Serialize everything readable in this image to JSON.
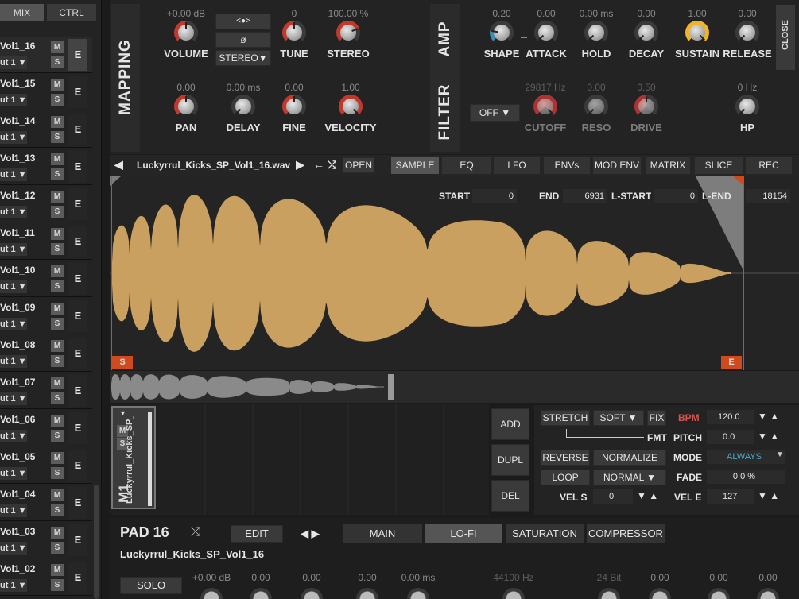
{
  "sidebar": {
    "tabs": [
      "MIX",
      "CTRL"
    ],
    "channels": [
      {
        "name": "Vol1_16",
        "out": "ut 1 ▼"
      },
      {
        "name": "Vol1_15",
        "out": "ut 1 ▼"
      },
      {
        "name": "Vol1_14",
        "out": "ut 1 ▼"
      },
      {
        "name": "Vol1_13",
        "out": "ut 1 ▼"
      },
      {
        "name": "Vol1_12",
        "out": "ut 1 ▼"
      },
      {
        "name": "Vol1_11",
        "out": "ut 1 ▼"
      },
      {
        "name": "Vol1_10",
        "out": "ut 1 ▼"
      },
      {
        "name": "Vol1_09",
        "out": "ut 1 ▼"
      },
      {
        "name": "Vol1_08",
        "out": "ut 1 ▼"
      },
      {
        "name": "Vol1_07",
        "out": "ut 1 ▼"
      },
      {
        "name": "Vol1_06",
        "out": "ut 1 ▼"
      },
      {
        "name": "Vol1_05",
        "out": "ut 1 ▼"
      },
      {
        "name": "Vol1_04",
        "out": "ut 1 ▼"
      },
      {
        "name": "Vol1_03",
        "out": "ut 1 ▼"
      },
      {
        "name": "Vol1_02",
        "out": "ut 1 ▼"
      }
    ],
    "m_label": "M",
    "s_label": "S",
    "e_label": "E"
  },
  "mapping": {
    "title": "MAPPING",
    "knobs": [
      {
        "label": "VOLUME",
        "value": "+0.00 dB",
        "accent": "#c0392b",
        "level": 0.5
      },
      {
        "label": "TUNE",
        "value": "0",
        "accent": "#c0392b",
        "level": 0.5
      },
      {
        "label": "STEREO",
        "value": "100.00 %",
        "accent": "#c0392b",
        "level": 0.75
      },
      {
        "label": "PAN",
        "value": "0.00",
        "accent": "#c0392b",
        "level": 0.5
      },
      {
        "label": "DELAY",
        "value": "0.00 ms",
        "accent": "#c0392b",
        "level": 0.0
      },
      {
        "label": "FINE",
        "value": "0.00",
        "accent": "#c0392b",
        "level": 0.5
      },
      {
        "label": "VELOCITY",
        "value": "1.00",
        "accent": "#c0392b",
        "level": 1.0
      }
    ],
    "stereo_buttons": [
      "<●>",
      "ø",
      "STEREO▼"
    ]
  },
  "amp": {
    "title": "AMP",
    "knobs": [
      {
        "label": "SHAPE",
        "value": "0.20",
        "accent": "#3a8fb7",
        "level": 0.2
      },
      {
        "label": "ATTACK",
        "value": "0.00",
        "accent": "#d4a017",
        "level": 0.0
      },
      {
        "label": "HOLD",
        "value": "0.00 ms",
        "accent": "#d4a017",
        "level": 0.0
      },
      {
        "label": "DECAY",
        "value": "0.00",
        "accent": "#d4a017",
        "level": 0.0
      },
      {
        "label": "SUSTAIN",
        "value": "1.00",
        "accent": "#f0b429",
        "level": 1.0
      },
      {
        "label": "RELEASE",
        "value": "0.00",
        "accent": "#d4a017",
        "level": 0.0
      }
    ],
    "close_label": "CLOSE"
  },
  "filter": {
    "title": "FILTER",
    "type_value": "OFF ▼",
    "knobs": [
      {
        "label": "CUTOFF",
        "value": "29817 Hz",
        "accent": "#a33",
        "level": 1.0
      },
      {
        "label": "RESO",
        "value": "0.00",
        "accent": "#555",
        "level": 0.0
      },
      {
        "label": "DRIVE",
        "value": "0.50",
        "accent": "#a33",
        "level": 0.5
      }
    ],
    "hp": {
      "label": "HP",
      "value": "0 Hz",
      "accent": "#3a8fb7",
      "level": 0.0
    }
  },
  "sample_bar": {
    "prev": "◀",
    "filename": "Luckyrrul_Kicks_SP_Vol1_16.wav",
    "next": "▶",
    "back": "←",
    "shuffle": "⤮",
    "open": "OPEN",
    "tabs": [
      "SAMPLE",
      "EQ",
      "LFO",
      "ENVs",
      "MOD ENV",
      "MATRIX",
      "SLICE",
      "REC"
    ],
    "active_tab": "SAMPLE"
  },
  "wave": {
    "start_label": "START",
    "start_value": "0",
    "end_label": "END",
    "end_value": "6931",
    "lstart_label": "L-START",
    "lstart_value": "0",
    "lend_label": "L-END",
    "lend_value": "18154",
    "s_marker": "S",
    "e_marker": "E",
    "wave_color": "#c9a060"
  },
  "slot": {
    "name": "Luckyrrul_Kicks_SP_Vo",
    "pad": "M1",
    "m": "M",
    "s": "S"
  },
  "slot_buttons": [
    "ADD",
    "DUPL",
    "DEL"
  ],
  "sample_settings": {
    "stretch": "STRETCH",
    "soft": "SOFT ▼",
    "fix": "FIX",
    "bpm_label": "BPM",
    "bpm_value": "120.0",
    "fmt": "FMT",
    "pitch_label": "PITCH",
    "pitch_value": "0.0",
    "reverse": "REVERSE",
    "normalize": "NORMALIZE",
    "mode_label": "MODE",
    "mode_value": "ALWAYS",
    "loop": "LOOP",
    "loop_mode": "NORMAL ▼",
    "fade_label": "FADE",
    "fade_value": "0.0 %",
    "vels_label": "VEL S",
    "vels_value": "0",
    "vele_label": "VEL E",
    "vele_value": "127",
    "arrows": "▼ ▲"
  },
  "pad": {
    "title": "PAD 16",
    "shuffle": "⤮",
    "edit": "EDIT",
    "nav": "◀ ▶",
    "tabs": [
      "MAIN",
      "LO-FI",
      "SATURATION",
      "COMPRESSOR"
    ],
    "active_tab": "LO-FI",
    "sample_name": "Luckyrrul_Kicks_SP_Vol1_16",
    "solo": "SOLO",
    "bottom_values": [
      "+0.00 dB",
      "0.00",
      "0.00",
      "0.00",
      "0.00 ms",
      "44100 Hz",
      "24 Bit",
      "0.00",
      "0.00",
      "0.00"
    ]
  }
}
